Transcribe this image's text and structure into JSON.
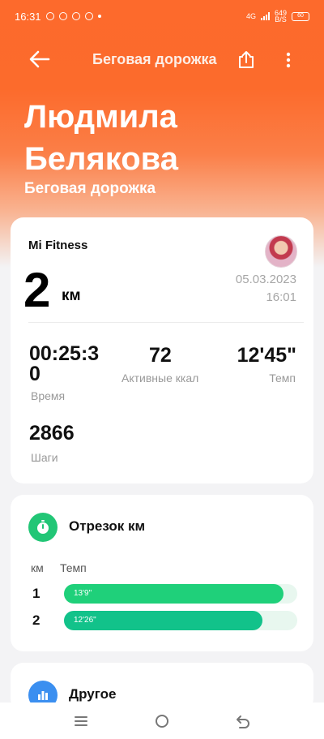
{
  "status_bar": {
    "time": "16:31",
    "network": "4G",
    "speed": "649",
    "speed_unit": "B/S",
    "battery": "60"
  },
  "app_bar": {
    "title": "Беговая дорожка",
    "back_icon": "arrow-left-icon",
    "share_icon": "share-icon",
    "more_icon": "more-vertical-icon"
  },
  "hero": {
    "user_name": "Людмила Белякова",
    "activity": "Беговая дорожка"
  },
  "summary": {
    "source": "Mi Fitness",
    "distance": "2",
    "distance_unit": "км",
    "date": "05.03.2023",
    "time": "16:01"
  },
  "stats": [
    {
      "value": "00:25:30",
      "label": "Время"
    },
    {
      "value": "72",
      "label": "Активные ккал"
    },
    {
      "value": "12'45\"",
      "label": "Темп"
    },
    {
      "value": "2866",
      "label": "Шаги"
    }
  ],
  "splits": {
    "title": "Отрезок км",
    "col_km": "км",
    "col_pace": "Темп",
    "rows": [
      {
        "km": "1",
        "pace": "13'9\"",
        "fill": 0.94,
        "color": "#1fd07a"
      },
      {
        "km": "2",
        "pace": "12'26\"",
        "fill": 0.85,
        "color": "#12c28a"
      }
    ]
  },
  "other": {
    "title": "Другое"
  },
  "colors": {
    "accent": "#fd6a2c",
    "green": "#22c676",
    "blue": "#3b8ff0"
  }
}
